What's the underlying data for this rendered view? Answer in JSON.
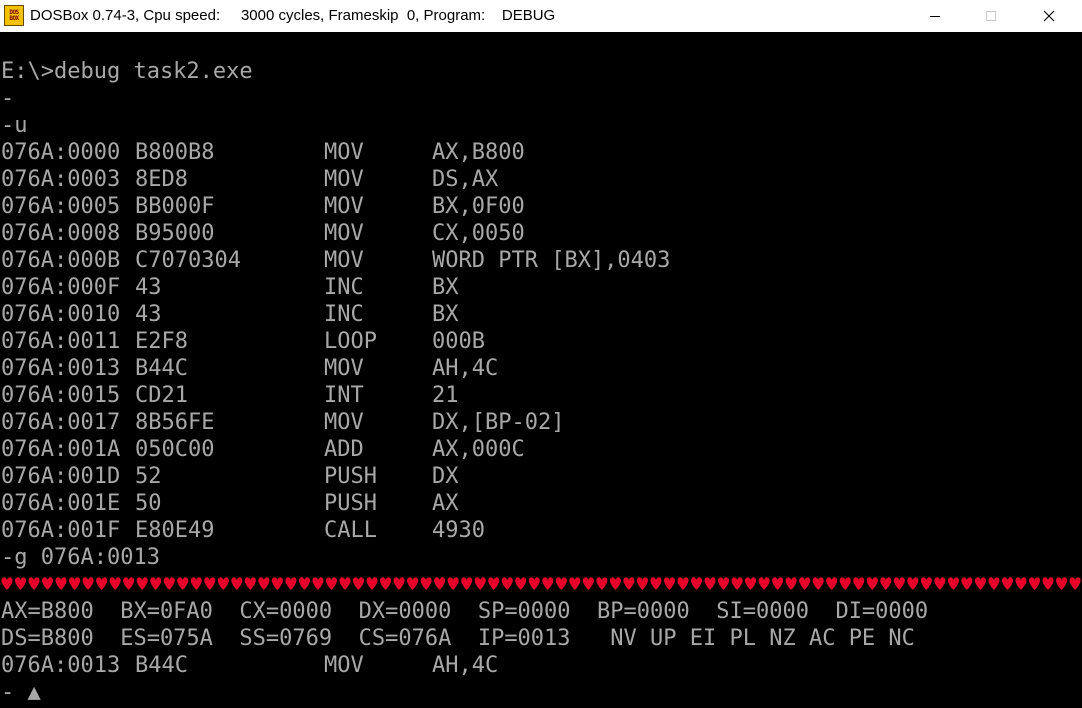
{
  "window": {
    "title": "DOSBox 0.74-3, Cpu speed:     3000 cycles, Frameskip  0, Program:    DEBUG",
    "icon_label_top": "DOS",
    "icon_label_bottom": "BOX",
    "minimize_icon": "minimize-icon",
    "maximize_icon": "maximize-icon",
    "close_icon": "close-icon"
  },
  "colors": {
    "terminal_text": "#a8a8a8",
    "terminal_bg": "#000000",
    "hearts": "#e8002a"
  },
  "terminal": {
    "command": "E:\\>debug task2.exe",
    "prompt_blank": "-",
    "unassemble_cmd": "-u",
    "disassembly": [
      {
        "address": "076A:0000",
        "bytes": "B800B8",
        "mnemonic": "MOV",
        "operands": "AX,B800"
      },
      {
        "address": "076A:0003",
        "bytes": "8ED8",
        "mnemonic": "MOV",
        "operands": "DS,AX"
      },
      {
        "address": "076A:0005",
        "bytes": "BB000F",
        "mnemonic": "MOV",
        "operands": "BX,0F00"
      },
      {
        "address": "076A:0008",
        "bytes": "B95000",
        "mnemonic": "MOV",
        "operands": "CX,0050"
      },
      {
        "address": "076A:000B",
        "bytes": "C7070304",
        "mnemonic": "MOV",
        "operands": "WORD PTR [BX],0403"
      },
      {
        "address": "076A:000F",
        "bytes": "43",
        "mnemonic": "INC",
        "operands": "BX"
      },
      {
        "address": "076A:0010",
        "bytes": "43",
        "mnemonic": "INC",
        "operands": "BX"
      },
      {
        "address": "076A:0011",
        "bytes": "E2F8",
        "mnemonic": "LOOP",
        "operands": "000B"
      },
      {
        "address": "076A:0013",
        "bytes": "B44C",
        "mnemonic": "MOV",
        "operands": "AH,4C"
      },
      {
        "address": "076A:0015",
        "bytes": "CD21",
        "mnemonic": "INT",
        "operands": "21"
      },
      {
        "address": "076A:0017",
        "bytes": "8B56FE",
        "mnemonic": "MOV",
        "operands": "DX,[BP-02]"
      },
      {
        "address": "076A:001A",
        "bytes": "050C00",
        "mnemonic": "ADD",
        "operands": "AX,000C"
      },
      {
        "address": "076A:001D",
        "bytes": "52",
        "mnemonic": "PUSH",
        "operands": "DX"
      },
      {
        "address": "076A:001E",
        "bytes": "50",
        "mnemonic": "PUSH",
        "operands": "AX"
      },
      {
        "address": "076A:001F",
        "bytes": "E80E49",
        "mnemonic": "CALL",
        "operands": "4930"
      }
    ],
    "go_cmd": "-g 076A:0013",
    "heart_glyph": "♥",
    "registers_line1": "AX=B800  BX=0FA0  CX=0000  DX=0000  SP=0000  BP=0000  SI=0000  DI=0000",
    "registers_line2": "DS=B800  ES=075A  SS=0769  CS=076A  IP=0013   NV UP EI PL NZ AC PE NC",
    "current_instruction": {
      "address": "076A:0013",
      "bytes": "B44C",
      "mnemonic": "MOV",
      "operands": "AH,4C"
    },
    "final_prompt": "- ▲"
  }
}
